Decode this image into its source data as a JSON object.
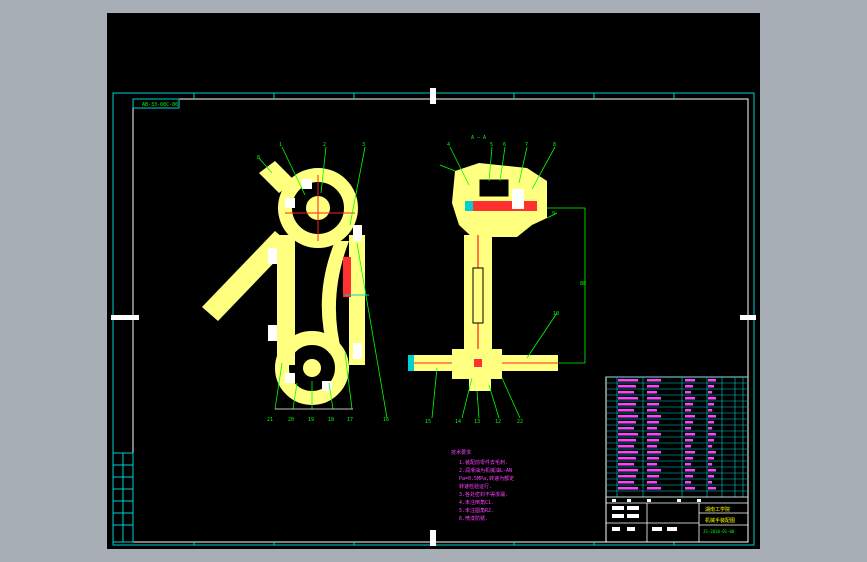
{
  "drawing": {
    "code_label": "AB-33-00C-00",
    "section_label": "A — A",
    "tech_title": "技术要求",
    "tech_notes": [
      "1.装配前零件去毛刺.",
      "2.润滑油为机械油L-AN",
      "  Pa=0.5MPa,转速为额定",
      "  转速检验运行.",
      "3.各处密封不得渗漏.",
      "4.未注倒角C1.",
      "5.未注圆角R2.",
      "6.喷漆防锈."
    ],
    "balloons_left": [
      "21",
      "20",
      "19",
      "18",
      "17",
      "16"
    ],
    "balloons_mid": [
      "15",
      "14",
      "13",
      "12",
      "22"
    ],
    "balloons_top_left": [
      "1",
      "2",
      "3"
    ],
    "balloons_top_right": [
      "4",
      "5",
      "6",
      "7",
      "8"
    ],
    "side_labels": [
      "9",
      "10"
    ],
    "dim_label": "88",
    "title_block": {
      "company": "湖南工学院",
      "drawing_name": "机械手装配图",
      "drawing_no": "JS-2010-01-00"
    }
  },
  "colors": {
    "part": "#ffff80",
    "frame": "#00d0d0",
    "leader": "#00ff00",
    "section": "#ff2020",
    "notes": "#ff40ff"
  }
}
